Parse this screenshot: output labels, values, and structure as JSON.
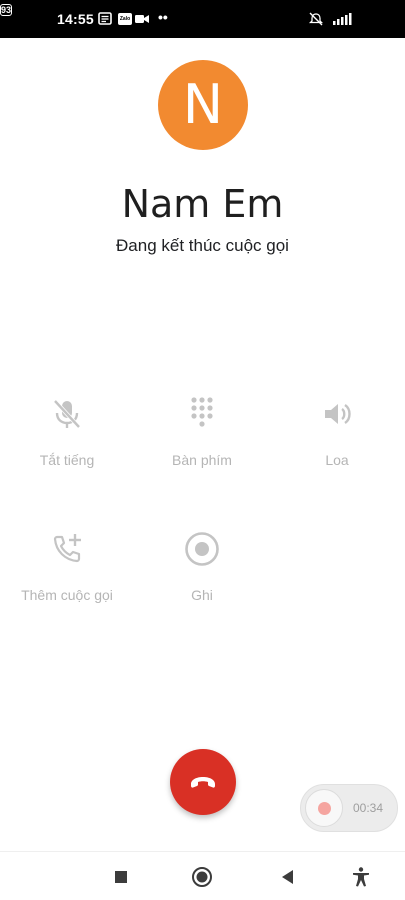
{
  "status_bar": {
    "time": "14:55",
    "zalo_label": "Zalo",
    "dots": "••",
    "battery": "93"
  },
  "caller": {
    "initial": "N",
    "name": "Nam Em",
    "status": "Đang kết thúc cuộc gọi",
    "avatar_color": "#f28a30"
  },
  "controls": {
    "mute": {
      "label": "Tắt tiếng",
      "icon": "mic-off-icon"
    },
    "keypad": {
      "label": "Bàn phím",
      "icon": "dialpad-icon"
    },
    "speaker": {
      "label": "Loa",
      "icon": "speaker-icon"
    },
    "add_call": {
      "label": "Thêm cuộc gọi",
      "icon": "add-call-icon"
    },
    "record": {
      "label": "Ghi",
      "icon": "record-icon"
    }
  },
  "end_call": {
    "icon": "end-call-icon",
    "color": "#d93025"
  },
  "recorder": {
    "time": "00:34"
  },
  "nav": {
    "items": [
      "recents-square-icon",
      "home-circle-icon",
      "back-triangle-icon",
      "accessibility-icon"
    ]
  }
}
